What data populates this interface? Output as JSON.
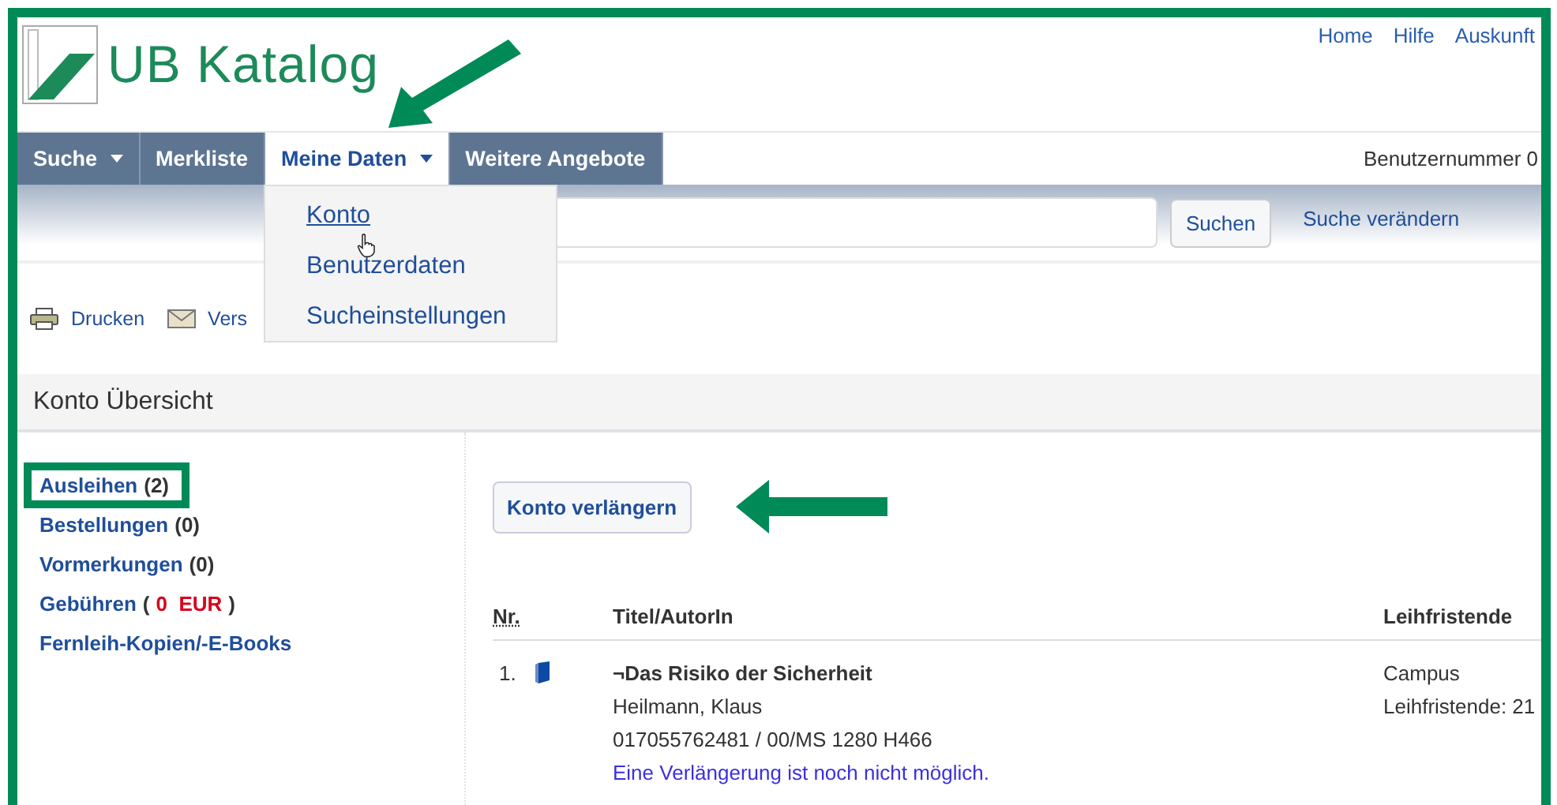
{
  "logo": {
    "text": "UB Katalog"
  },
  "top_links": [
    "Home",
    "Hilfe",
    "Auskunft"
  ],
  "nav": {
    "tabs": [
      {
        "label": "Suche",
        "dropdown": true,
        "selected": false
      },
      {
        "label": "Merkliste",
        "dropdown": false,
        "selected": false
      },
      {
        "label": "Meine Daten",
        "dropdown": true,
        "selected": true
      },
      {
        "label": "Weitere Angebote",
        "dropdown": false,
        "selected": false
      }
    ],
    "user_number": "Benutzernummer 0"
  },
  "dropdown_menu": {
    "items": [
      {
        "label": "Konto",
        "selected": true
      },
      {
        "label": "Benutzerdaten",
        "selected": false
      },
      {
        "label": "Sucheinstellungen",
        "selected": false
      }
    ]
  },
  "search": {
    "button": "Suchen",
    "link": "Suche verändern"
  },
  "toolbar": [
    {
      "kind": "print",
      "label": "Drucken"
    },
    {
      "kind": "mail",
      "label": "Vers"
    }
  ],
  "section_title": "Konto Übersicht",
  "sidebar": {
    "items": [
      {
        "label": "Ausleihen",
        "count": "(2)",
        "highlighted": true
      },
      {
        "label": "Bestellungen",
        "count": "(0)",
        "highlighted": false
      },
      {
        "label": "Vormerkungen",
        "count": "(0)",
        "highlighted": false
      },
      {
        "label": "Gebühren",
        "open": "(",
        "amount": "0  EUR",
        "close": ")",
        "highlighted": false
      },
      {
        "label": "Fernleih-Kopien/-E-Books",
        "highlighted": false
      }
    ]
  },
  "renew_button": "Konto verlängern",
  "table": {
    "columns": [
      "Nr.",
      "Titel/AutorIn",
      "Leihfristende"
    ],
    "rows": [
      {
        "nr": "1.",
        "title": "¬Das Risiko der Sicherheit",
        "author": "Heilmann, Klaus",
        "signature": "017055762481 / 00/MS 1280 H466",
        "note": "Eine Verlängerung ist noch nicht möglich.",
        "location": "Campus",
        "due": "Leihfristende: 21"
      }
    ]
  }
}
